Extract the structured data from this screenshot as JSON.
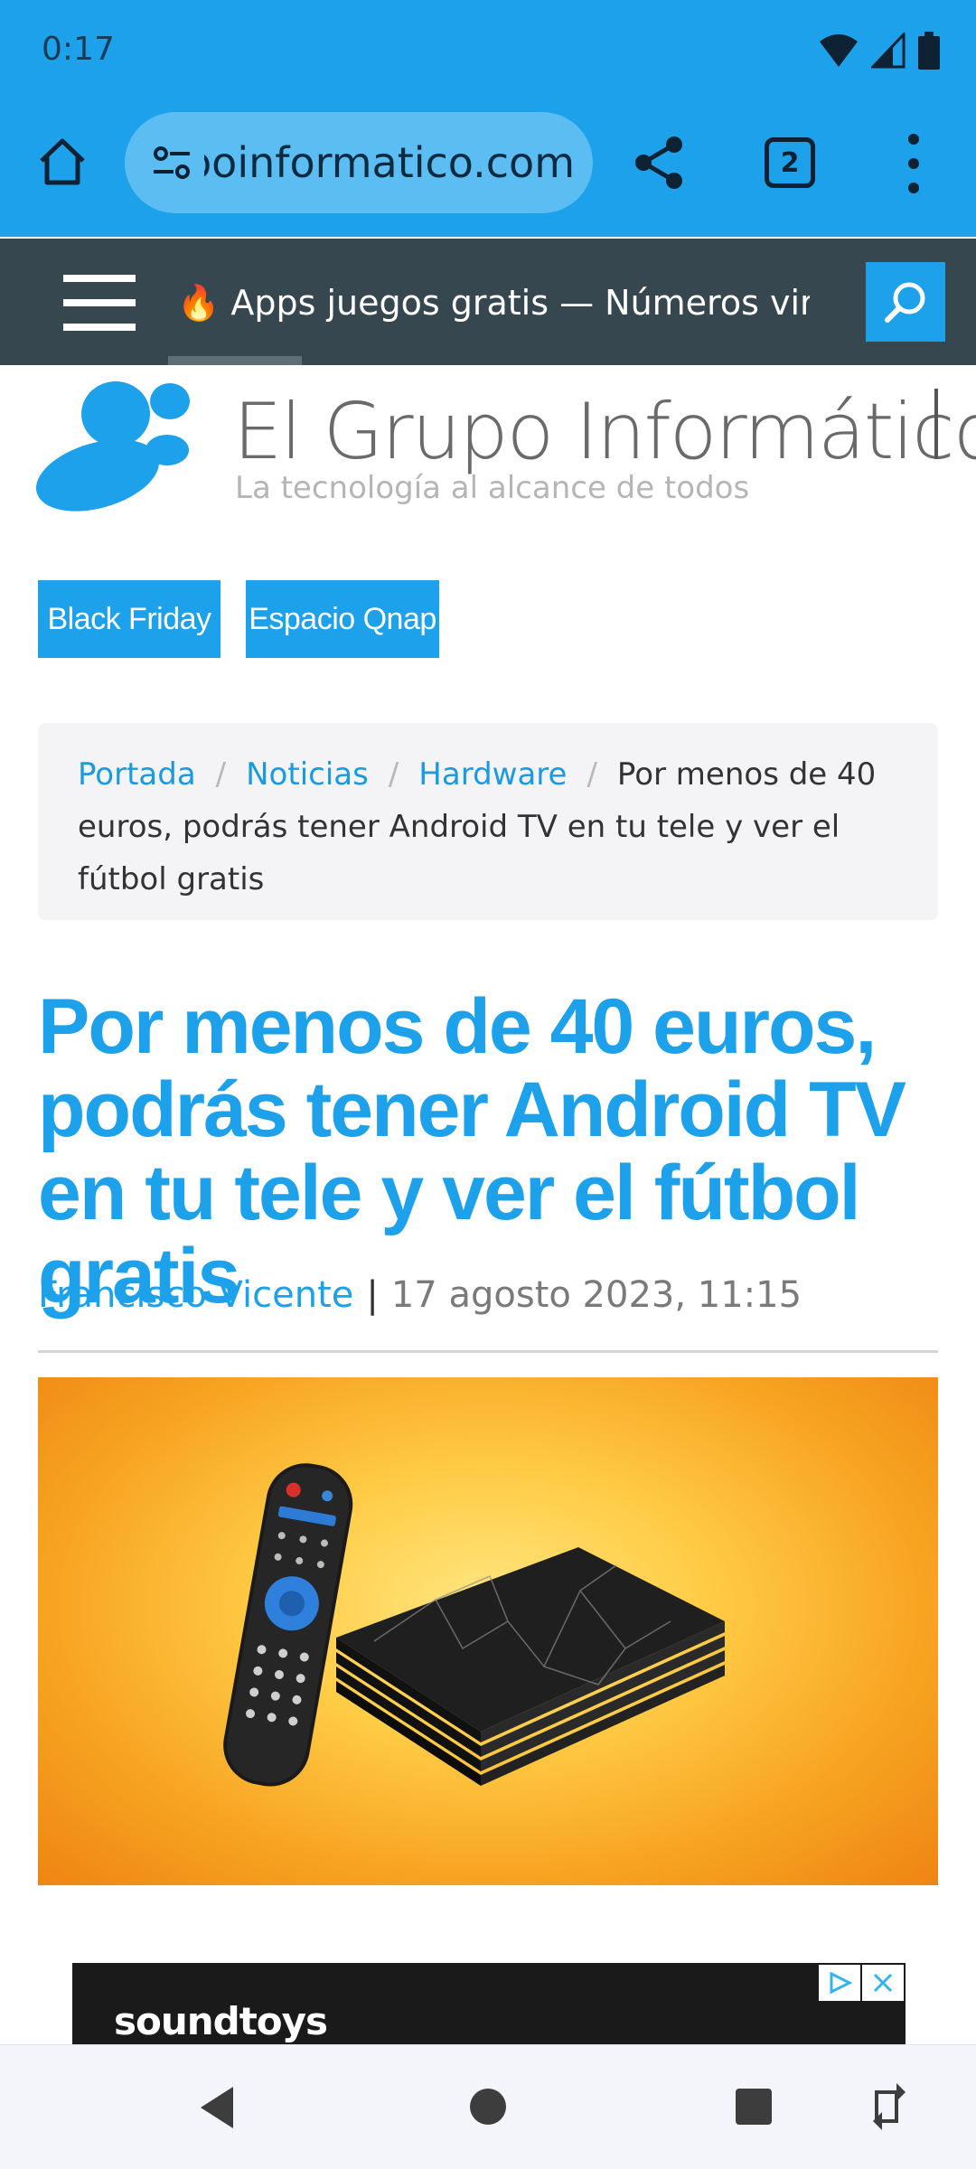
{
  "status_bar": {
    "time": "0:17",
    "icons": [
      "wifi-icon",
      "cell-signal-icon",
      "battery-icon"
    ]
  },
  "browser": {
    "url": "elgrupoinformatico.com",
    "tab_count": "2",
    "icons": [
      "home-icon",
      "site-settings-icon",
      "share-icon",
      "tab-switcher-icon",
      "overflow-menu-icon"
    ]
  },
  "site_nav": {
    "ticker_text": "Apps juegos gratis — Números virtuales",
    "ticker_icon": "fire-icon",
    "icons": [
      "hamburger-menu-icon",
      "search-icon"
    ]
  },
  "logo": {
    "title": "El Grupo Informático",
    "tagline": "La tecnología al alcance de todos"
  },
  "categories": [
    "Black Friday",
    "Espacio Qnap"
  ],
  "breadcrumb": {
    "items": [
      "Portada",
      "Noticias",
      "Hardware"
    ],
    "separator": "/",
    "current": "Por menos de 40 euros, podrás tener Android TV en tu tele y ver el fútbol gratis"
  },
  "article": {
    "title": "Por menos de 40 euros, podrás tener Android TV en tu tele y ver el fútbol gratis",
    "author": "Francisco Vicente",
    "separator": "|",
    "date": "17 agosto 2023, 11:15",
    "image_subject": "Android TV box with remote control"
  },
  "ad": {
    "brand": "soundtoys",
    "icons": [
      "ad-choices-icon",
      "close-icon"
    ]
  },
  "system_nav": {
    "icons": [
      "back-icon",
      "home-circle-icon",
      "recents-icon",
      "rotate-icon"
    ]
  },
  "colors": {
    "accent": "#1da1ea",
    "nav_dark": "#37474f",
    "breadcrumb_bg": "#f4f3f5"
  }
}
